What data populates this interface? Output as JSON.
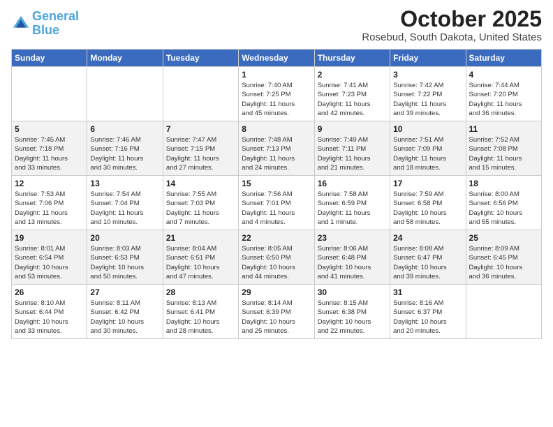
{
  "logo": {
    "line1": "General",
    "line2": "Blue"
  },
  "title": "October 2025",
  "subtitle": "Rosebud, South Dakota, United States",
  "days_header": [
    "Sunday",
    "Monday",
    "Tuesday",
    "Wednesday",
    "Thursday",
    "Friday",
    "Saturday"
  ],
  "weeks": [
    [
      {
        "num": "",
        "info": ""
      },
      {
        "num": "",
        "info": ""
      },
      {
        "num": "",
        "info": ""
      },
      {
        "num": "1",
        "info": "Sunrise: 7:40 AM\nSunset: 7:25 PM\nDaylight: 11 hours\nand 45 minutes."
      },
      {
        "num": "2",
        "info": "Sunrise: 7:41 AM\nSunset: 7:23 PM\nDaylight: 11 hours\nand 42 minutes."
      },
      {
        "num": "3",
        "info": "Sunrise: 7:42 AM\nSunset: 7:22 PM\nDaylight: 11 hours\nand 39 minutes."
      },
      {
        "num": "4",
        "info": "Sunrise: 7:44 AM\nSunset: 7:20 PM\nDaylight: 11 hours\nand 36 minutes."
      }
    ],
    [
      {
        "num": "5",
        "info": "Sunrise: 7:45 AM\nSunset: 7:18 PM\nDaylight: 11 hours\nand 33 minutes."
      },
      {
        "num": "6",
        "info": "Sunrise: 7:46 AM\nSunset: 7:16 PM\nDaylight: 11 hours\nand 30 minutes."
      },
      {
        "num": "7",
        "info": "Sunrise: 7:47 AM\nSunset: 7:15 PM\nDaylight: 11 hours\nand 27 minutes."
      },
      {
        "num": "8",
        "info": "Sunrise: 7:48 AM\nSunset: 7:13 PM\nDaylight: 11 hours\nand 24 minutes."
      },
      {
        "num": "9",
        "info": "Sunrise: 7:49 AM\nSunset: 7:11 PM\nDaylight: 11 hours\nand 21 minutes."
      },
      {
        "num": "10",
        "info": "Sunrise: 7:51 AM\nSunset: 7:09 PM\nDaylight: 11 hours\nand 18 minutes."
      },
      {
        "num": "11",
        "info": "Sunrise: 7:52 AM\nSunset: 7:08 PM\nDaylight: 11 hours\nand 15 minutes."
      }
    ],
    [
      {
        "num": "12",
        "info": "Sunrise: 7:53 AM\nSunset: 7:06 PM\nDaylight: 11 hours\nand 13 minutes."
      },
      {
        "num": "13",
        "info": "Sunrise: 7:54 AM\nSunset: 7:04 PM\nDaylight: 11 hours\nand 10 minutes."
      },
      {
        "num": "14",
        "info": "Sunrise: 7:55 AM\nSunset: 7:03 PM\nDaylight: 11 hours\nand 7 minutes."
      },
      {
        "num": "15",
        "info": "Sunrise: 7:56 AM\nSunset: 7:01 PM\nDaylight: 11 hours\nand 4 minutes."
      },
      {
        "num": "16",
        "info": "Sunrise: 7:58 AM\nSunset: 6:59 PM\nDaylight: 11 hours\nand 1 minute."
      },
      {
        "num": "17",
        "info": "Sunrise: 7:59 AM\nSunset: 6:58 PM\nDaylight: 10 hours\nand 58 minutes."
      },
      {
        "num": "18",
        "info": "Sunrise: 8:00 AM\nSunset: 6:56 PM\nDaylight: 10 hours\nand 55 minutes."
      }
    ],
    [
      {
        "num": "19",
        "info": "Sunrise: 8:01 AM\nSunset: 6:54 PM\nDaylight: 10 hours\nand 53 minutes."
      },
      {
        "num": "20",
        "info": "Sunrise: 8:03 AM\nSunset: 6:53 PM\nDaylight: 10 hours\nand 50 minutes."
      },
      {
        "num": "21",
        "info": "Sunrise: 8:04 AM\nSunset: 6:51 PM\nDaylight: 10 hours\nand 47 minutes."
      },
      {
        "num": "22",
        "info": "Sunrise: 8:05 AM\nSunset: 6:50 PM\nDaylight: 10 hours\nand 44 minutes."
      },
      {
        "num": "23",
        "info": "Sunrise: 8:06 AM\nSunset: 6:48 PM\nDaylight: 10 hours\nand 41 minutes."
      },
      {
        "num": "24",
        "info": "Sunrise: 8:08 AM\nSunset: 6:47 PM\nDaylight: 10 hours\nand 39 minutes."
      },
      {
        "num": "25",
        "info": "Sunrise: 8:09 AM\nSunset: 6:45 PM\nDaylight: 10 hours\nand 36 minutes."
      }
    ],
    [
      {
        "num": "26",
        "info": "Sunrise: 8:10 AM\nSunset: 6:44 PM\nDaylight: 10 hours\nand 33 minutes."
      },
      {
        "num": "27",
        "info": "Sunrise: 8:11 AM\nSunset: 6:42 PM\nDaylight: 10 hours\nand 30 minutes."
      },
      {
        "num": "28",
        "info": "Sunrise: 8:13 AM\nSunset: 6:41 PM\nDaylight: 10 hours\nand 28 minutes."
      },
      {
        "num": "29",
        "info": "Sunrise: 8:14 AM\nSunset: 6:39 PM\nDaylight: 10 hours\nand 25 minutes."
      },
      {
        "num": "30",
        "info": "Sunrise: 8:15 AM\nSunset: 6:38 PM\nDaylight: 10 hours\nand 22 minutes."
      },
      {
        "num": "31",
        "info": "Sunrise: 8:16 AM\nSunset: 6:37 PM\nDaylight: 10 hours\nand 20 minutes."
      },
      {
        "num": "",
        "info": ""
      }
    ]
  ]
}
